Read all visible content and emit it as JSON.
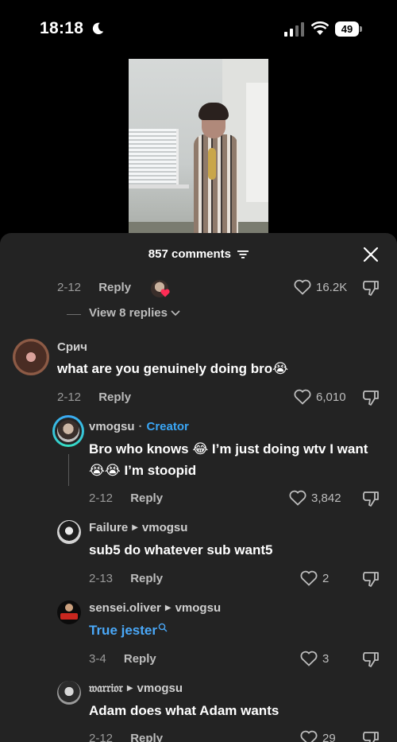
{
  "status": {
    "time": "18:18",
    "battery": "49"
  },
  "header": {
    "title": "857 comments"
  },
  "top_reply_row": {
    "date": "2-12",
    "reply": "Reply",
    "likes": "16.2K"
  },
  "view_replies": "View 8 replies",
  "comments": [
    {
      "username": "Срич",
      "text": "what are you genuinely doing bro😭",
      "date": "2-12",
      "reply": "Reply",
      "likes": "6,010"
    },
    {
      "username": "vmogsu",
      "creator": "Creator",
      "text": "Bro who knows 😂 I’m just doing wtv I want 😭😭 I’m stoopid",
      "date": "2-12",
      "reply": "Reply",
      "likes": "3,842"
    },
    {
      "username": "Failure",
      "reply_to": "vmogsu",
      "text": "sub5 do whatever sub want5",
      "date": "2-13",
      "reply": "Reply",
      "likes": "2"
    },
    {
      "username": "sensei.oliver",
      "reply_to": "vmogsu",
      "text": "True jester",
      "date": "3-4",
      "reply": "Reply",
      "likes": "3"
    },
    {
      "username": "𝔴𝔞𝔯𝔯𝔦𝔬𝔯",
      "reply_to": "vmogsu",
      "text": "Adam does what Adam wants",
      "date": "2-12",
      "reply": "Reply",
      "likes": "29"
    }
  ],
  "colors": {
    "sheet": "#232323",
    "creator": "#3aa6f5",
    "link": "#4aa8f8"
  },
  "icons": [
    "moon-icon",
    "signal-icon",
    "wifi-icon",
    "battery-icon",
    "filter-icon",
    "close-icon",
    "heart-icon",
    "dislike-icon",
    "search-icon",
    "chevron-down-icon"
  ]
}
